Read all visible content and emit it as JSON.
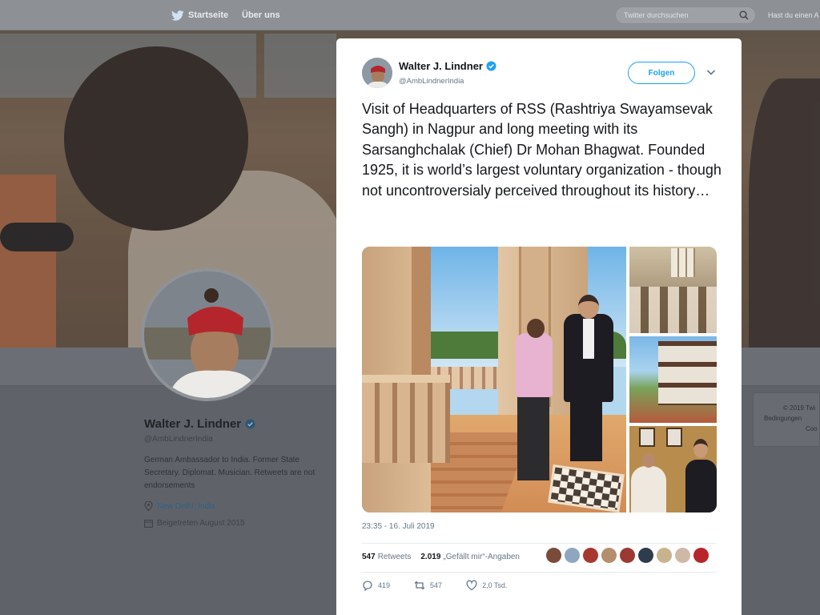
{
  "nav": {
    "home_label": "Startseite",
    "about_label": "Über uns",
    "search_placeholder": "Twitter durchsuchen",
    "account_prompt": "Hast du einen A"
  },
  "profile": {
    "name": "Walter J. Lindner",
    "handle": "@AmbLindnerIndia",
    "bio": "German Ambassador to India. Former State Secretary. Diplomat. Musician. Retweets are not endorsements",
    "location": "New Delhi, India",
    "joined": "Beigetreten August 2015",
    "side_footer": [
      "© 2019 Twi",
      "Bedingungen",
      "Coo"
    ]
  },
  "tweet": {
    "author_name": "Walter J. Lindner",
    "author_handle": "@AmbLindnerIndia",
    "follow_label": "Folgen",
    "text": "Visit of Headquarters of RSS (Rashtriya Swayamsevak Sangh) in Nagpur and long meeting with its Sarsanghchalak (Chief) Dr Mohan Bhagwat. Founded 1925, it is world’s largest voluntary organization - though not uncontroversialy perceived throughout its history…",
    "timestamp": "23:35 - 16. Juli 2019",
    "retweets_count": "547",
    "retweets_label": "Retweets",
    "likes_count": "2.019",
    "likes_label": "„Gefällt mir“-Angaben",
    "replies": "419",
    "retweet_action_count": "547",
    "like_action_count": "2,0 Tsd.",
    "liker_colors": [
      "#7a4b3a",
      "#8fa6bf",
      "#a8372f",
      "#b38f6d",
      "#9a3a32",
      "#2e3c4d",
      "#c7b48f",
      "#d0b8a8",
      "#b8242a"
    ]
  },
  "colors": {
    "accent": "#1da1f2",
    "verified": "#1da1f2"
  }
}
